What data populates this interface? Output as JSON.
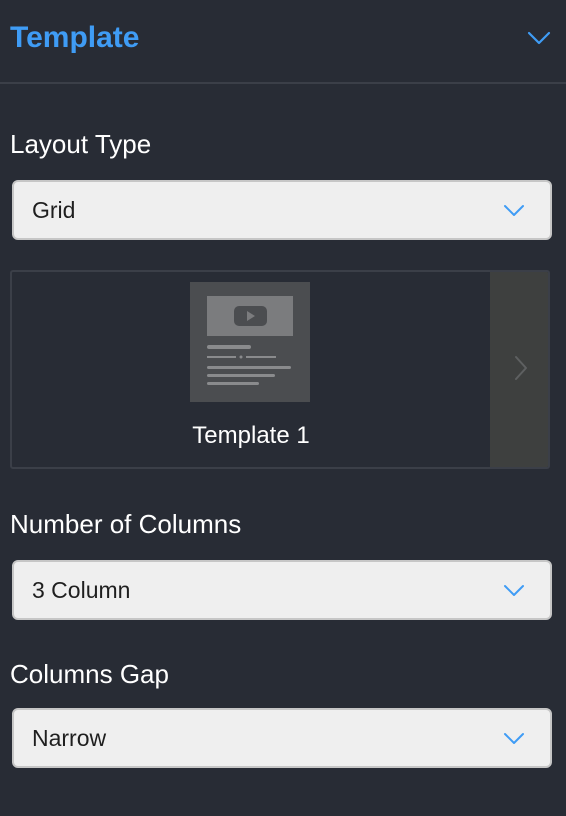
{
  "panel": {
    "title": "Template",
    "collapse_icon": "chevron-down-icon",
    "accent_color": "#3f9cf5"
  },
  "layout_type": {
    "label": "Layout Type",
    "selected": "Grid"
  },
  "template_carousel": {
    "items": [
      {
        "label": "Template 1",
        "thumbnail_icon": "video-play-icon"
      }
    ],
    "next_icon": "chevron-right-icon"
  },
  "columns": {
    "label": "Number of Columns",
    "selected": "3 Column"
  },
  "columns_gap": {
    "label": "Columns Gap",
    "selected": "Narrow"
  }
}
